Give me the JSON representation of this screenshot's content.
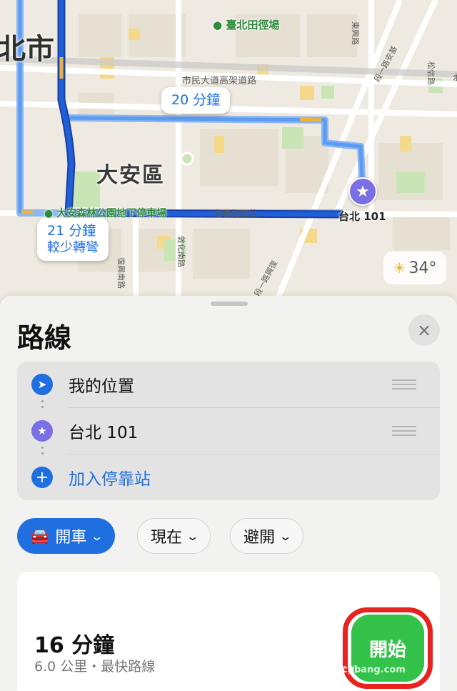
{
  "map": {
    "city_label": "北市",
    "district_label": "大安區",
    "poi_top": "臺北田徑場",
    "poi_park": "大安森林公園地下停車場",
    "road_top": "市民大道高架道路",
    "road_mid": "信義路四段",
    "road_right_1": "東興路",
    "road_right_2": "松信路",
    "road_right_3": "永",
    "road_diag_1": "段一路興復",
    "road_diag_2": "段一路安基",
    "road_left": "復興南路",
    "road_left_2": "敦化南路",
    "road_mid2": "段二路興復",
    "callout_1": {
      "time": "20 分鐘"
    },
    "callout_2": {
      "time": "21 分鐘",
      "note": "較少轉彎"
    },
    "destination": "台北 101",
    "weather": {
      "icon": "partly-sunny-icon",
      "temp": "34°"
    },
    "colors": {
      "route_primary": "#1f5fd8",
      "route_alt": "#5b9bf0",
      "dest_pin": "#7b6fe6"
    }
  },
  "sheet": {
    "title": "路線",
    "close_icon": "×",
    "stops": [
      {
        "icon": "location-arrow-icon",
        "label": "我的位置",
        "color": "#1f6fe0"
      },
      {
        "icon": "star-icon",
        "label": "台北 101",
        "color": "#7b6fe6"
      },
      {
        "icon": "plus-icon",
        "label": "加入停靠站",
        "color": "#1f6fe0"
      }
    ],
    "chips": {
      "mode": "開車",
      "time": "現在",
      "avoid": "避開"
    },
    "route": {
      "duration": "16 分鐘",
      "meta": "6.0 公里・最快路線",
      "go_label": "開始"
    },
    "watermark": "T客邦",
    "watermark_url": "techbang.com"
  }
}
